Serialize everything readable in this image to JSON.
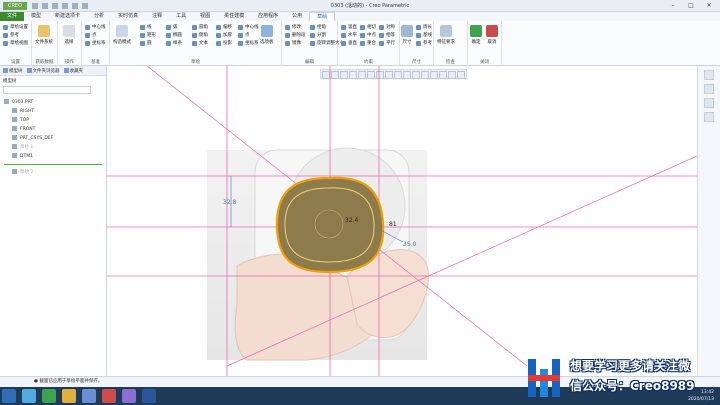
{
  "window": {
    "app_badge": "CREO",
    "title": "0303 (活动的) - Creo Parametric"
  },
  "ribbon_tabs": [
    "文件",
    "模型",
    "新建选项卡",
    "分析",
    "实时仿真",
    "注释",
    "工具",
    "视图",
    "柔性建模",
    "应用程序",
    "公用",
    "草绘"
  ],
  "ribbon": {
    "setup": {
      "items": [
        "草绘设置",
        "参考",
        "草绘视图"
      ],
      "label": "设置"
    },
    "get_data": {
      "items": [
        "文件系统"
      ],
      "label": "获取数据"
    },
    "operations": {
      "items": [
        "选择"
      ],
      "label": "操作"
    },
    "datum": {
      "items": [
        "中心线",
        "点",
        "坐标系"
      ],
      "label": "基准"
    },
    "sketch": {
      "items": [
        "构造模式",
        "线",
        "矩形",
        "圆",
        "弧",
        "椭圆",
        "样条",
        "圆角",
        "倒角",
        "文本",
        "偏移",
        "加厚",
        "投影",
        "中心线",
        "点",
        "坐标系",
        "选项板"
      ],
      "label": "草绘"
    },
    "editing": {
      "items": [
        "修改",
        "删除段",
        "镜像",
        "拐角",
        "分割",
        "旋转调整大小"
      ],
      "label": "编辑"
    },
    "constrain": {
      "items": [
        "竖直",
        "相切",
        "对称",
        "水平",
        "中点",
        "相等",
        "重合",
        "平行",
        "垂直"
      ],
      "label": "约束"
    },
    "dimension": {
      "items": [
        "尺寸",
        "周长",
        "基线",
        "参考"
      ],
      "label": "尺寸"
    },
    "inspect": {
      "items": [
        "特征要求"
      ],
      "label": "检查"
    },
    "close": {
      "items": [
        "确定",
        "取消"
      ],
      "label": "关闭"
    }
  },
  "left_panel": {
    "tabs": [
      "模型树",
      "文件夹浏览器",
      "收藏夹"
    ],
    "search_label": "模型树",
    "tree": [
      "0303.PRT",
      "RIGHT",
      "TOP",
      "FRONT",
      "PRT_CSYS_DEF",
      "草绘 1",
      "DTM1",
      "草绘 2"
    ],
    "tree_dim": [
      false,
      false,
      false,
      false,
      false,
      true,
      false,
      true
    ]
  },
  "canvas": {
    "dimensions": [
      "32.8",
      "32.4",
      "35.0",
      "81"
    ]
  },
  "status": {
    "message": "● 截面已应用于草绘平面并保存。"
  },
  "taskbar": {
    "time": "13:42",
    "date": "2020/07/13"
  },
  "watermark": {
    "line1": "想要学习更多请关注微",
    "line2": "信公众号：Creo8989"
  },
  "colors": {
    "file_tab": "#3c8a2e",
    "datum": "#e76bb0",
    "sketch": "#f0a000",
    "watermark": "#1565c0"
  }
}
